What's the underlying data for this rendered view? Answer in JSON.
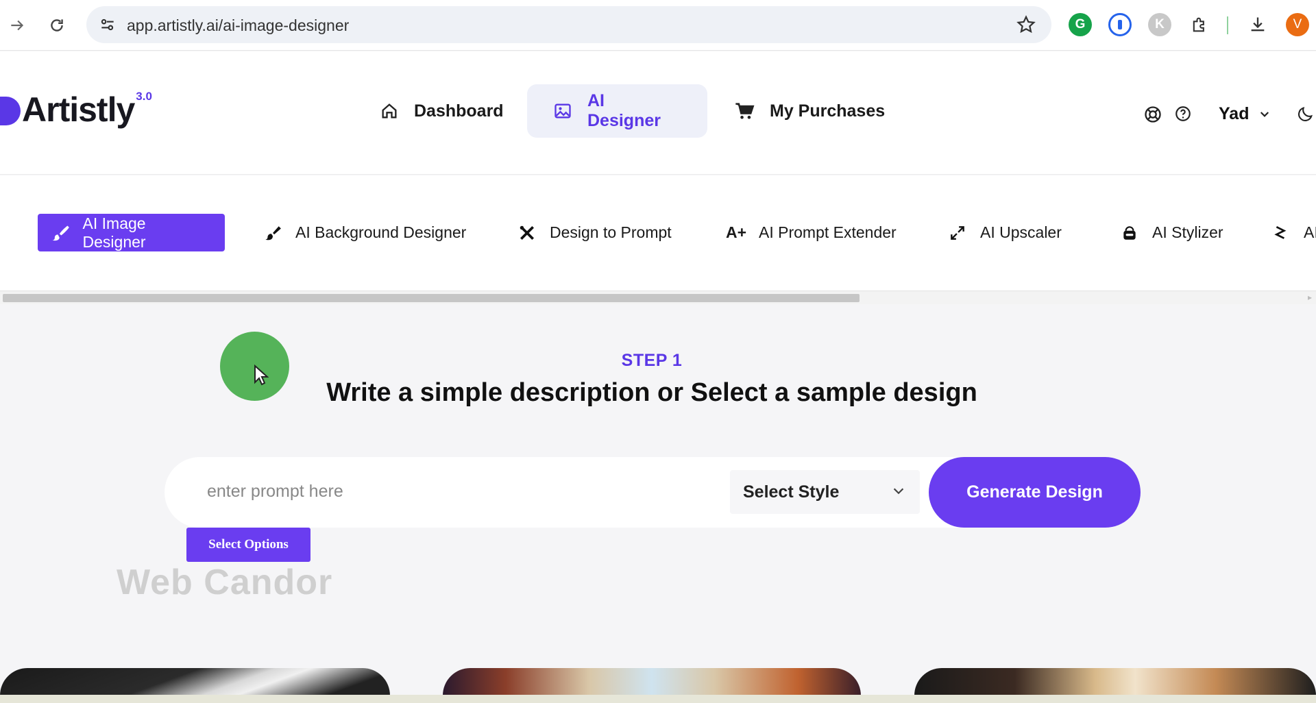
{
  "browser": {
    "url": "app.artistly.ai/ai-image-designer",
    "profile_initial": "V",
    "extension_k_initial": "K"
  },
  "app": {
    "logo_text": "Artistly",
    "logo_version": "3.0",
    "nav": [
      {
        "label": "Dashboard",
        "icon": "home-icon",
        "active": false
      },
      {
        "label": "AI Designer",
        "icon": "image-icon",
        "active": true
      },
      {
        "label": "My Purchases",
        "icon": "cart-icon",
        "active": false
      }
    ],
    "user_name": "Yad"
  },
  "tools": [
    {
      "label": "AI Image Designer",
      "icon": "brush-icon",
      "active": true
    },
    {
      "label": "AI Background Designer",
      "icon": "paint-brush-icon",
      "active": false
    },
    {
      "label": "Design to Prompt",
      "icon": "tools-icon",
      "active": false
    },
    {
      "label": "AI Prompt Extender",
      "icon": "a-plus-icon",
      "active": false
    },
    {
      "label": "AI Upscaler",
      "icon": "expand-icon",
      "active": false
    },
    {
      "label": "AI Stylizer",
      "icon": "stylizer-icon",
      "active": false
    },
    {
      "label": "AI",
      "icon": "zigzag-icon",
      "active": false
    }
  ],
  "step": {
    "label": "STEP 1",
    "title": "Write a simple description or Select a sample design"
  },
  "prompt": {
    "placeholder": "enter prompt here",
    "value": "",
    "style_select": "Select Style",
    "generate_label": "Generate Design",
    "options_label": "Select Options"
  },
  "watermark": "Web Candor",
  "colors": {
    "accent": "#6a3df0",
    "accent_text": "#5a37e6",
    "cursor_highlight": "#4caf50"
  }
}
